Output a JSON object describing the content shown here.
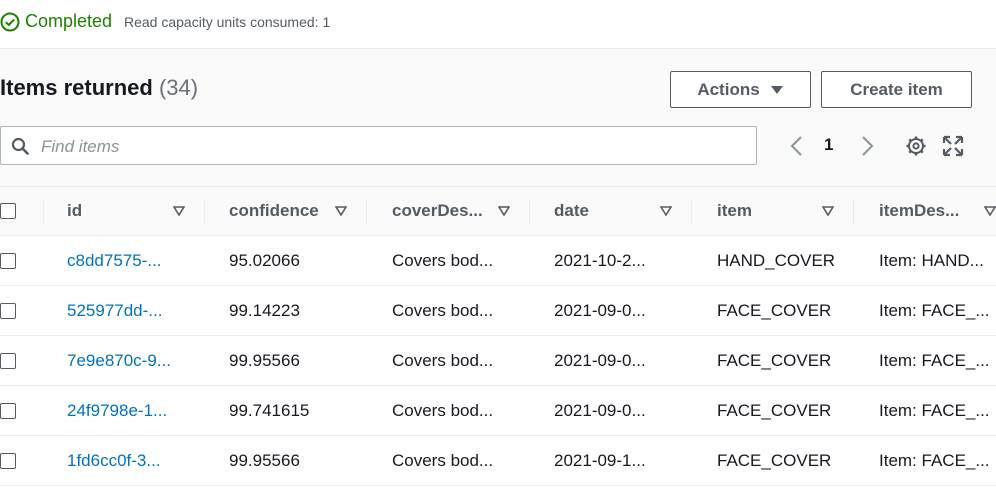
{
  "status": {
    "text": "Completed",
    "meta": "Read capacity units consumed: 1",
    "icon": "check-circle-icon",
    "color": "#1d8102"
  },
  "panel": {
    "title": "Items returned",
    "count": "(34)",
    "actions_label": "Actions",
    "create_label": "Create item",
    "search": {
      "placeholder": "Find items",
      "value": ""
    },
    "pagination": {
      "page": "1"
    }
  },
  "table": {
    "columns": [
      "id",
      "confidence",
      "coverDes...",
      "date",
      "item",
      "itemDes..."
    ],
    "rows": [
      [
        "c8dd7575-...",
        "95.02066",
        "Covers bod...",
        "2021-10-2...",
        "HAND_COVER",
        "Item: HAND..."
      ],
      [
        "525977dd-...",
        "99.14223",
        "Covers bod...",
        "2021-09-0...",
        "FACE_COVER",
        "Item: FACE_..."
      ],
      [
        "7e9e870c-9...",
        "99.95566",
        "Covers bod...",
        "2021-09-0...",
        "FACE_COVER",
        "Item: FACE_..."
      ],
      [
        "24f9798e-1...",
        "99.741615",
        "Covers bod...",
        "2021-09-0...",
        "FACE_COVER",
        "Item: FACE_..."
      ],
      [
        "1fd6cc0f-3...",
        "99.95566",
        "Covers bod...",
        "2021-09-1...",
        "FACE_COVER",
        "Item: FACE_..."
      ]
    ]
  },
  "colors": {
    "link": "#0073bb",
    "success": "#1d8102",
    "border": "#eaeded"
  }
}
